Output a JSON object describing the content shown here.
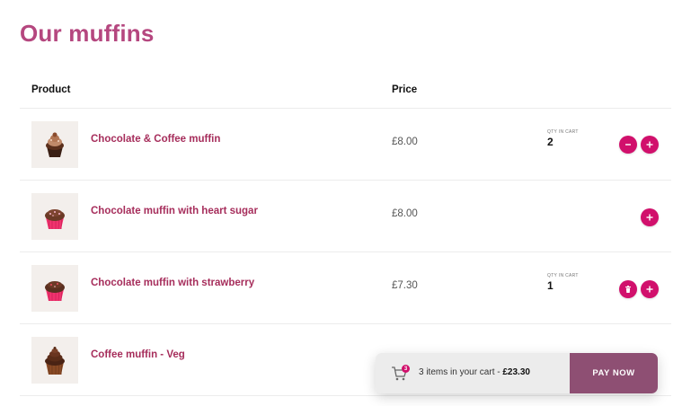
{
  "page": {
    "title": "Our muffins"
  },
  "table": {
    "col_product": "Product",
    "col_price": "Price"
  },
  "products": [
    {
      "name": "Chocolate & Coffee muffin",
      "price": "£8.00",
      "qty_label": "QTY IN CART",
      "qty": "2"
    },
    {
      "name": "Chocolate muffin with heart sugar",
      "price": "£8.00",
      "qty_label": "",
      "qty": ""
    },
    {
      "name": "Chocolate muffin with strawberry",
      "price": "£7.30",
      "qty_label": "QTY IN CART",
      "qty": "1"
    },
    {
      "name": "Coffee muffin - Veg",
      "price": "",
      "qty_label": "",
      "qty": ""
    }
  ],
  "cart": {
    "badge": "3",
    "summary": "3 items in your cart - ",
    "total": "£23.30",
    "pay_label": "PAY NOW"
  },
  "colors": {
    "title": "#b5477f",
    "product_name": "#a62d5b",
    "accent": "#d1106c",
    "pay_button": "#8e4f73"
  }
}
